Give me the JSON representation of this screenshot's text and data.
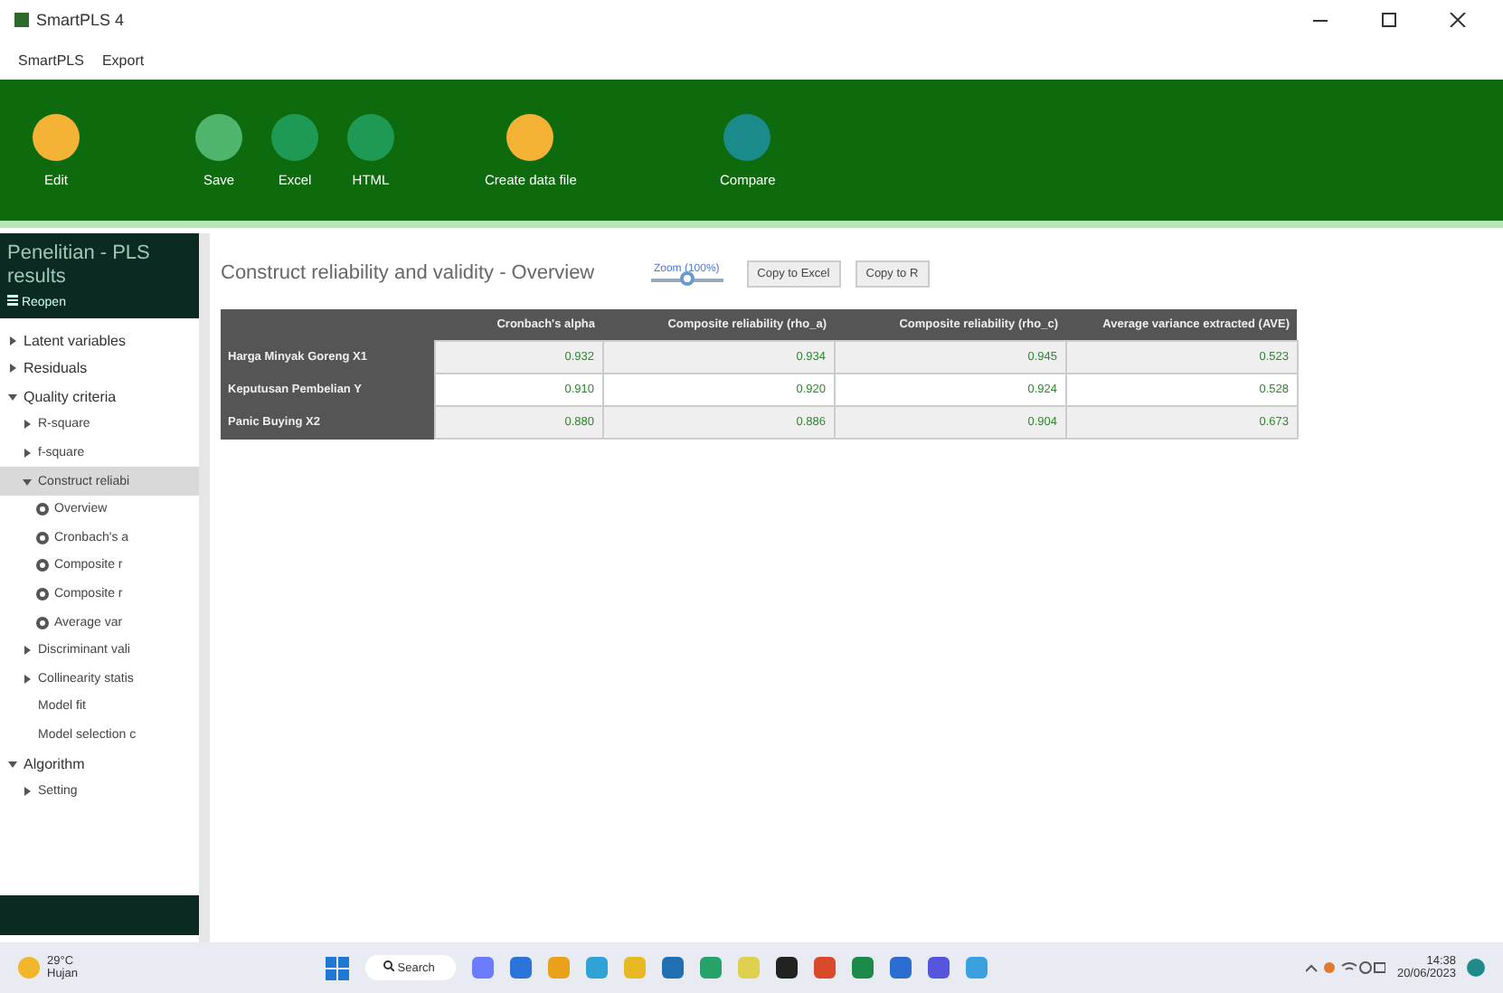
{
  "window": {
    "title": "SmartPLS 4"
  },
  "menu": [
    "SmartPLS",
    "Export"
  ],
  "toolbar": [
    {
      "label": "Edit",
      "color": "#f5b335"
    },
    {
      "label": "Save",
      "color": "#4fb56c"
    },
    {
      "label": "Excel",
      "color": "#1f9a55"
    },
    {
      "label": "HTML",
      "color": "#1f9a55"
    },
    {
      "label": "Create data file",
      "color": "#f5b335"
    },
    {
      "label": "Compare",
      "color": "#1a8a8a"
    }
  ],
  "sidebar": {
    "title": "Penelitian - PLS results",
    "subtitle": "Reopen",
    "items": [
      {
        "kind": "folder",
        "label": "Latent variables",
        "expanded": false,
        "selected": false
      },
      {
        "kind": "folder",
        "label": "Residuals",
        "expanded": false,
        "selected": false
      },
      {
        "kind": "folder",
        "label": "Quality criteria",
        "expanded": true,
        "selected": false,
        "children": [
          {
            "kind": "folder",
            "label": "R-square",
            "expanded": false,
            "selected": false
          },
          {
            "kind": "folder",
            "label": "f-square",
            "expanded": false,
            "selected": false
          },
          {
            "kind": "folder",
            "label": "Construct reliabi",
            "expanded": true,
            "selected": true,
            "children": [
              {
                "kind": "radio",
                "label": "Overview",
                "selected": false
              },
              {
                "kind": "radio",
                "label": "Cronbach's a",
                "selected": false
              },
              {
                "kind": "radio",
                "label": "Composite r",
                "selected": false
              },
              {
                "kind": "radio",
                "label": "Composite r",
                "selected": false
              },
              {
                "kind": "radio",
                "label": "Average var",
                "selected": false
              }
            ]
          },
          {
            "kind": "folder",
            "label": "Discriminant vali",
            "expanded": false,
            "selected": false
          },
          {
            "kind": "folder",
            "label": "Collinearity statis",
            "expanded": false,
            "selected": false
          },
          {
            "kind": "leaf",
            "label": "Model fit",
            "selected": false
          },
          {
            "kind": "leaf",
            "label": "Model selection c",
            "selected": false
          }
        ]
      },
      {
        "kind": "folder",
        "label": "Algorithm",
        "expanded": true,
        "selected": false,
        "children": [
          {
            "kind": "folder",
            "label": "Setting",
            "expanded": false,
            "selected": false
          }
        ]
      }
    ]
  },
  "content": {
    "title": "Construct reliability and validity - Overview",
    "zoom": {
      "label": "Zoom (100%)",
      "level": 0.5
    },
    "buttons": [
      "Copy to Excel",
      "Copy to R"
    ],
    "table": {
      "columns": [
        "Cronbach's alpha",
        "Composite reliability (rho_a)",
        "Composite reliability (rho_c)",
        "Average variance extracted (AVE)"
      ],
      "rows": [
        {
          "name": "Harga Minyak Goreng X1",
          "values": [
            "0.932",
            "0.934",
            "0.945",
            "0.523"
          ]
        },
        {
          "name": "Keputusan Pembelian Y",
          "values": [
            "0.910",
            "0.920",
            "0.924",
            "0.528"
          ]
        },
        {
          "name": "Panic Buying X2",
          "values": [
            "0.880",
            "0.886",
            "0.904",
            "0.673"
          ]
        }
      ]
    }
  },
  "taskbar": {
    "weather": {
      "temp": "29°C",
      "condition": "Hujan"
    },
    "search": "Search",
    "time": "14:38",
    "date": "20/06/2023"
  }
}
